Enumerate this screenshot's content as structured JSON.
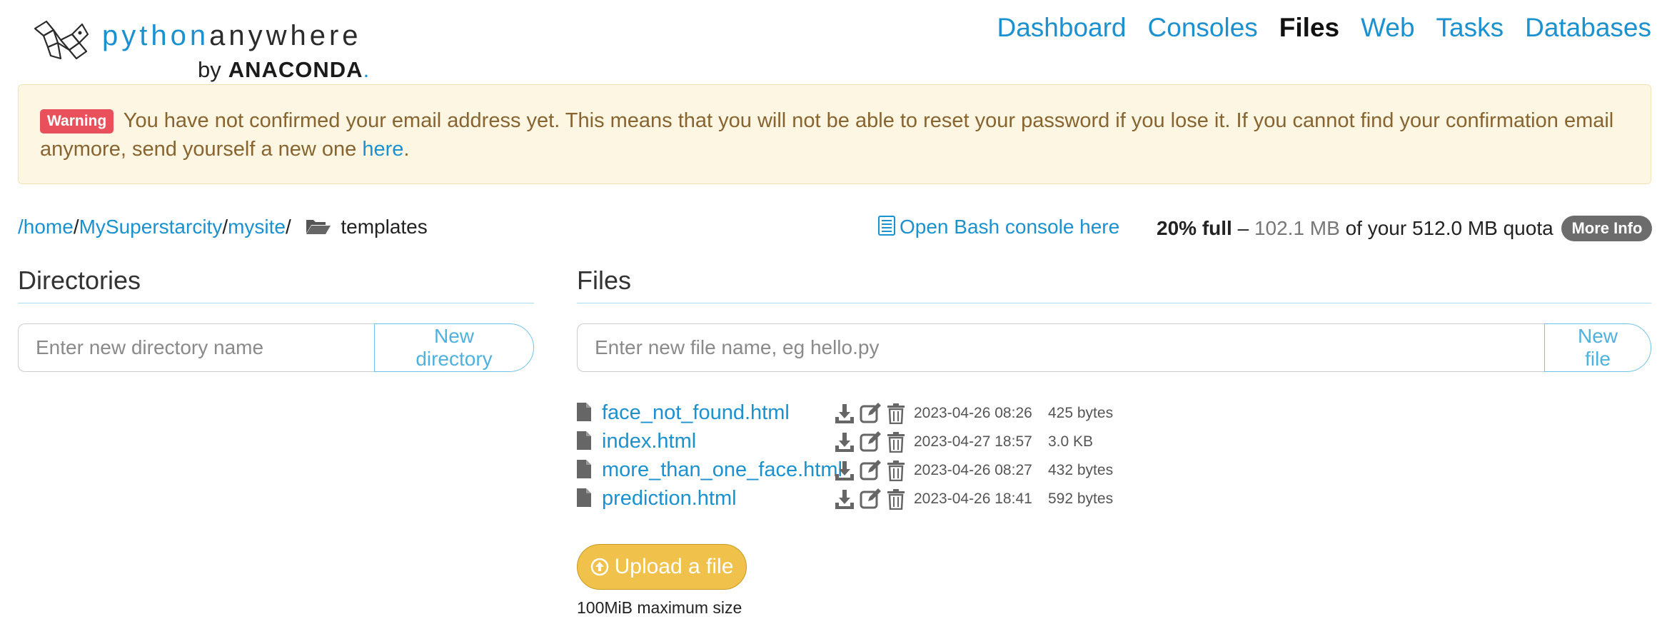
{
  "brand": {
    "python": "python",
    "anywhere": "anywhere",
    "by": "by",
    "anaconda": "ANACONDA",
    "dot": "."
  },
  "nav": [
    {
      "label": "Dashboard",
      "active": false
    },
    {
      "label": "Consoles",
      "active": false
    },
    {
      "label": "Files",
      "active": true
    },
    {
      "label": "Web",
      "active": false
    },
    {
      "label": "Tasks",
      "active": false
    },
    {
      "label": "Databases",
      "active": false
    }
  ],
  "warning": {
    "badge": "Warning",
    "text": "You have not confirmed your email address yet. This means that you will not be able to reset your password if you lose it. If you cannot find your confirmation email anymore, send yourself a new one",
    "link": "here",
    "end": "."
  },
  "breadcrumb": {
    "root": "/home",
    "user": "MySuperstarcity",
    "site": "mysite",
    "sep": "/",
    "current": "templates"
  },
  "bash_link": "Open Bash console here",
  "quota": {
    "percent": "20% full",
    "dash": "–",
    "used": "102.1 MB",
    "text": "of your 512.0 MB quota",
    "more_info": "More Info"
  },
  "directories": {
    "heading": "Directories",
    "placeholder": "Enter new directory name",
    "button": "New directory"
  },
  "files_section": {
    "heading": "Files",
    "placeholder": "Enter new file name, eg hello.py",
    "button": "New file"
  },
  "files": [
    {
      "name": "face_not_found.html",
      "date": "2023-04-26 08:26",
      "size": "425 bytes"
    },
    {
      "name": "index.html",
      "date": "2023-04-27 18:57",
      "size": "3.0 KB"
    },
    {
      "name": "more_than_one_face.html",
      "date": "2023-04-26 08:27",
      "size": "432 bytes"
    },
    {
      "name": "prediction.html",
      "date": "2023-04-26 18:41",
      "size": "592 bytes"
    }
  ],
  "upload": {
    "label": "Upload a file",
    "max": "100MiB maximum size"
  },
  "colors": {
    "link": "#1b91d0",
    "warning_bg": "#fcf6e3",
    "warning_text": "#876430",
    "badge": "#e8515b",
    "upload": "#f0c24b"
  }
}
